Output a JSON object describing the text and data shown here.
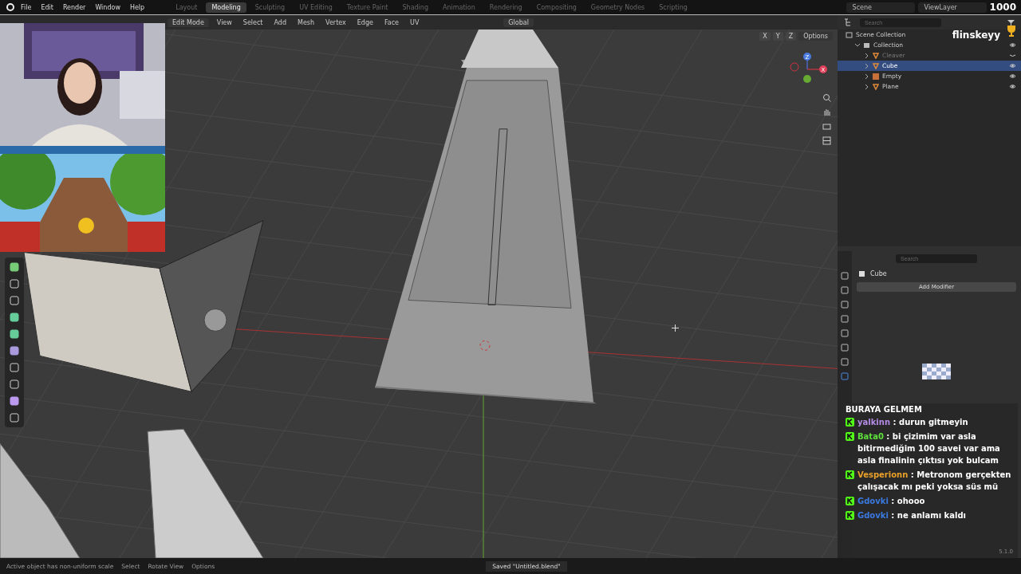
{
  "top_menu": [
    "File",
    "Edit",
    "Render",
    "Window",
    "Help"
  ],
  "workspaces": [
    {
      "label": "Layout",
      "selected": false
    },
    {
      "label": "Modeling",
      "selected": true
    },
    {
      "label": "Sculpting",
      "selected": false
    },
    {
      "label": "UV Editing",
      "selected": false
    },
    {
      "label": "Texture Paint",
      "selected": false
    },
    {
      "label": "Shading",
      "selected": false
    },
    {
      "label": "Animation",
      "selected": false
    },
    {
      "label": "Rendering",
      "selected": false
    },
    {
      "label": "Compositing",
      "selected": false
    },
    {
      "label": "Geometry Nodes",
      "selected": false
    },
    {
      "label": "Scripting",
      "selected": false
    }
  ],
  "scene": "Scene",
  "view_layer": "ViewLayer",
  "stream_overlay": {
    "counter": "1000",
    "channel": "flinskeyy"
  },
  "viewport_header": {
    "mode": "Edit Mode",
    "menus": [
      "View",
      "Select",
      "Add",
      "Mesh",
      "Vertex",
      "Edge",
      "Face",
      "UV"
    ],
    "orientation": "Global",
    "axes": [
      "X",
      "Y",
      "Z"
    ],
    "options": "Options"
  },
  "gizmo": {
    "labels": [
      "Z",
      "X"
    ]
  },
  "outliner": {
    "search": {
      "placeholder": "Search"
    },
    "tree": [
      {
        "label": "Scene Collection",
        "kind": "scene",
        "selected": false,
        "children": [
          {
            "label": "Collection",
            "kind": "collection",
            "selected": false,
            "hidden": false,
            "expanded": true,
            "children": [
              {
                "label": "Cleaver",
                "kind": "mesh",
                "selected": false,
                "hidden": true,
                "expanded": false
              },
              {
                "label": "Cube",
                "kind": "mesh",
                "selected": true,
                "hidden": false,
                "expanded": false
              },
              {
                "label": "Empty",
                "kind": "empty",
                "selected": false,
                "hidden": false,
                "expanded": false
              },
              {
                "label": "Plane",
                "kind": "mesh",
                "selected": false,
                "hidden": false,
                "expanded": false
              }
            ]
          }
        ]
      }
    ]
  },
  "properties": {
    "search": {
      "placeholder": "Search"
    },
    "object": "Cube",
    "add_button": "Add Modifier"
  },
  "chat": [
    {
      "kind": "fragment",
      "text": "BURAYA GELMEM"
    },
    {
      "kind": "message",
      "user": "yalkinn",
      "color": "#b48ce6",
      "text": ": durun gitmeyin"
    },
    {
      "kind": "message",
      "user": "Bata0",
      "color": "#5ee03c",
      "text": ": bi çizimim var asla bitirmediğim 100 savei var ama asla finalinin çıktısı yok bulcam"
    },
    {
      "kind": "message",
      "user": "Vesperionn",
      "color": "#e8a02a",
      "text": ": Metronom gerçekten çalışacak mı peki yoksa süs mü"
    },
    {
      "kind": "message",
      "user": "Gdovki",
      "color": "#3a7ae0",
      "text": ": ohooo"
    },
    {
      "kind": "message",
      "user": "Gdovki",
      "color": "#3a7ae0",
      "text": ": ne anlamı kaldı"
    }
  ],
  "status_bar": {
    "hints": [
      "Active object has non-uniform scale",
      "Select",
      "Rotate View",
      "Options"
    ],
    "message": "Saved \"Untitled.blend\"",
    "version": "5.1.0"
  }
}
